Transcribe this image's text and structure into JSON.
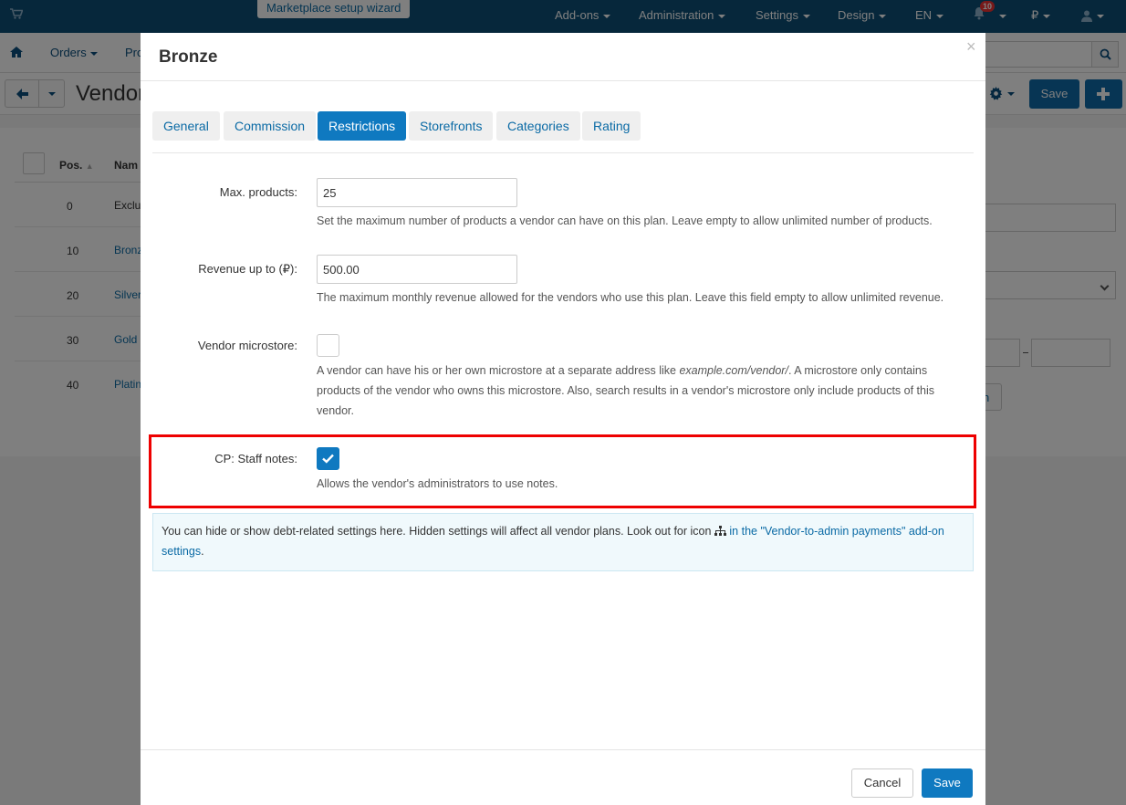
{
  "topbar": {
    "wizard_label": "Marketplace setup wizard",
    "items": [
      "Add-ons",
      "Administration",
      "Settings",
      "Design",
      "EN"
    ],
    "notifications_count": "10",
    "currency_symbol": "₽"
  },
  "subbar": {
    "items": [
      "Orders",
      "Pro"
    ]
  },
  "toolbar": {
    "page_title": "Vendor",
    "save_label": "Save"
  },
  "background_table": {
    "headers": {
      "pos": "Pos.",
      "name": "Nam"
    },
    "rows": [
      {
        "pos": "0",
        "name": "Exclu"
      },
      {
        "pos": "10",
        "name": "Bronz"
      },
      {
        "pos": "20",
        "name": "Silver"
      },
      {
        "pos": "30",
        "name": "Gold"
      },
      {
        "pos": "40",
        "name": "Platin"
      }
    ],
    "side_button_text": "n"
  },
  "modal": {
    "title": "Bronze",
    "close_symbol": "×",
    "tabs": [
      "General",
      "Commission",
      "Restrictions",
      "Storefronts",
      "Categories",
      "Rating"
    ],
    "active_tab": "Restrictions",
    "fields": {
      "max_products": {
        "label": "Max. products:",
        "value": "25",
        "help": "Set the maximum number of products a vendor can have on this plan. Leave empty to allow unlimited number of products."
      },
      "revenue": {
        "label": "Revenue up to (₽):",
        "value": "500.00",
        "help": "The maximum monthly revenue allowed for the vendors who use this plan. Leave this field empty to allow unlimited revenue."
      },
      "microstore": {
        "label": "Vendor microstore:",
        "checked": false,
        "help_prefix": "A vendor can have his or her own microstore at a separate address like ",
        "help_example": "example.com/vendor/",
        "help_suffix": ". A microstore only contains products of the vendor who owns this microstore. Also, search results in a vendor's microstore only include products of this vendor."
      },
      "staff_notes": {
        "label": "CP: Staff notes:",
        "checked": true,
        "help": "Allows the vendor's administrators to use notes."
      }
    },
    "info": {
      "text": "You can hide or show debt-related settings here. Hidden settings will affect all vendor plans. Look out for icon ",
      "link": "in the \"Vendor-to-admin payments\" add-on settings",
      "end": "."
    },
    "footer": {
      "cancel_label": "Cancel",
      "save_label": "Save"
    }
  },
  "colors": {
    "primary": "#0f79c0",
    "topbar": "#0c4e76",
    "highlight": "#ee0000"
  }
}
